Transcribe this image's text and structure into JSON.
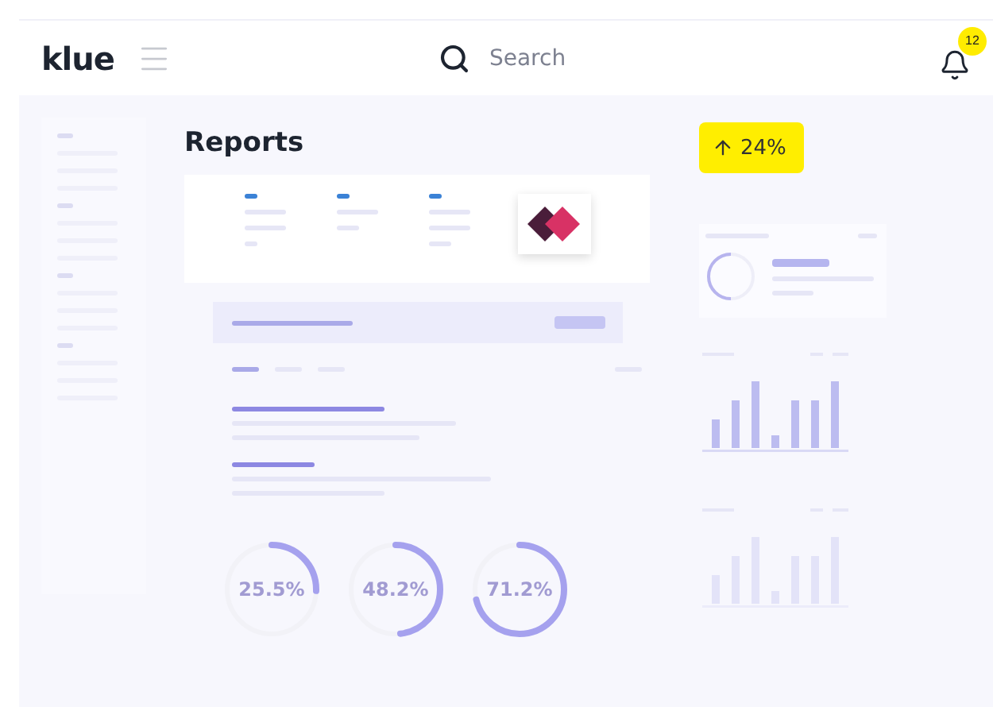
{
  "header": {
    "brand": "klue",
    "search": {
      "placeholder": "Search"
    },
    "notifications": {
      "count": "12"
    }
  },
  "page": {
    "title": "Reports"
  },
  "trend_badge": {
    "value": "24%"
  },
  "donuts": [
    {
      "label": "25.5%",
      "level": 0.255
    },
    {
      "label": "48.2%",
      "level": 0.482
    },
    {
      "label": "71.2%",
      "level": 0.712
    }
  ]
}
